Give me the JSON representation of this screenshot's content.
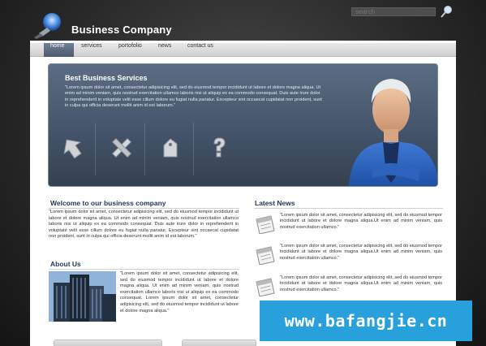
{
  "brand": {
    "name": "Business Company"
  },
  "search": {
    "placeholder": "search"
  },
  "nav": {
    "items": [
      "home",
      "services",
      "portofolio",
      "news",
      "contact us"
    ]
  },
  "banner": {
    "title": "Best Business Services",
    "text": "\"Lorem ipsum dolor sit amet, consectetur adipisicing elit, sed do eiusmod tempor incididunt ut labore et dolore magna aliqua. Ut enim ad minim veniam, quis nostrud exercitation ullamco laboris nisi ut aliquip ex ea commodo consequat. Duis aute irure dolor in reprehenderit in voluptate velit esse cillum dolore eu fugiat nulla pariatur. Excepteur sint occaecat cupidatat non proident, sunt in culpa qui officia deserunt mollit anim id est laborum.\"",
    "icons": [
      "arrow-up-icon",
      "tools-icon",
      "tag-icon",
      "question-icon"
    ]
  },
  "welcome": {
    "title": "Welcome to our business company",
    "text": "\"Lorem ipsum dolor sit amet, consectetur adipisicing elit, sed do eiusmod tempor incididunt ut labore et dolore magna aliqua. Ut enim ad minim veniam, quis nostrud exercitation ullamco laboris nisi ut aliquip ex ea commodo consequat. Duis aute irure dolor in reprehenderit in voluptate velit esse cillum dolore eu fugiat nulla pariatur. Excepteur sint occaecat cupidatat non proident, sunt in culpa qui officia deserunt mollit anim id est laborum.\""
  },
  "about": {
    "title": "About Us",
    "text": "\"Lorem ipsum dolor sit amet, consectetur adipisicing elit, sed do eiusmod tempor incididunt ut labore et dolore magna aliqua. Ut enim ad minim veniam, quis nostrud exercitation ullamco laboris nisi ut aliquip ex ea commodo consequat. Lorem ipsum dolor sit amet, consectetur adipisicing elit, sed do eiusmod tempor incididunt ut labore et dolore magna aliqua.\""
  },
  "news": {
    "title": "Latest News",
    "items": [
      "\"Lorem ipsum dolor sit amet, consectetur adipisicing elit, sed do eiusmod tempor incididunt ut labore et dolore magna aliqua.Ut enim ad minim veniam, quis nostrud exercitation ullamco.\"",
      "\"Lorem ipsum dolor sit amet, consectetur adipisicing elit, sed do eiusmod tempor incididunt ut labore et dolore magna aliqua.Ut enim ad minim veniam, quis nostrud exercitation ullamco.\"",
      "\"Lorem ipsum dolor sit amet, consectetur adipisicing elit, sed do eiusmod tempor incididunt ut labore et dolore magna aliqua.Ut enim ad minim veniam, quis nostrud exercitation ullamco.\""
    ]
  },
  "promo": {
    "text": "www.bafangjie.cn"
  }
}
